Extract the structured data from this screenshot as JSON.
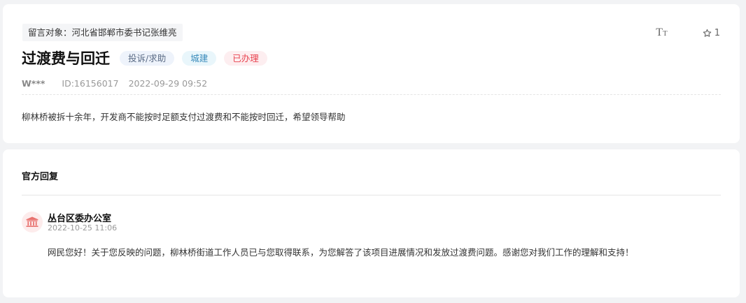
{
  "message": {
    "target": "留言对象：河北省邯郸市委书记张维亮",
    "title": "过渡费与回迁",
    "tags": {
      "type": "投诉/求助",
      "category": "城建",
      "status": "已办理"
    },
    "author": "W***",
    "id": "ID:16156017",
    "datetime": "2022-09-29 09:52",
    "content": "柳林桥被拆十余年，开发商不能按时足额支付过渡费和不能按时回迁，希望领导帮助",
    "tools": {
      "font_icon": "font-size-icon",
      "font_label_big": "T",
      "font_label_small": "T",
      "favorite_icon": "star-outline-icon",
      "favorite_count": "1"
    }
  },
  "reply": {
    "section_title": "官方回复",
    "org_icon": "government-building-icon",
    "org_name": "丛台区委办公室",
    "datetime": "2022-10-25 11:06",
    "text": "网民您好！关于您反映的问题，柳林桥街道工作人员已与您取得联系，为您解答了该项目进展情况和发放过渡费问题。感谢您对我们工作的理解和支持！"
  },
  "colors": {
    "page_bg": "#f2f3f5",
    "status_red": "#e8434f",
    "category_blue": "#3a8bbb",
    "avatar_red": "#e8726f"
  }
}
